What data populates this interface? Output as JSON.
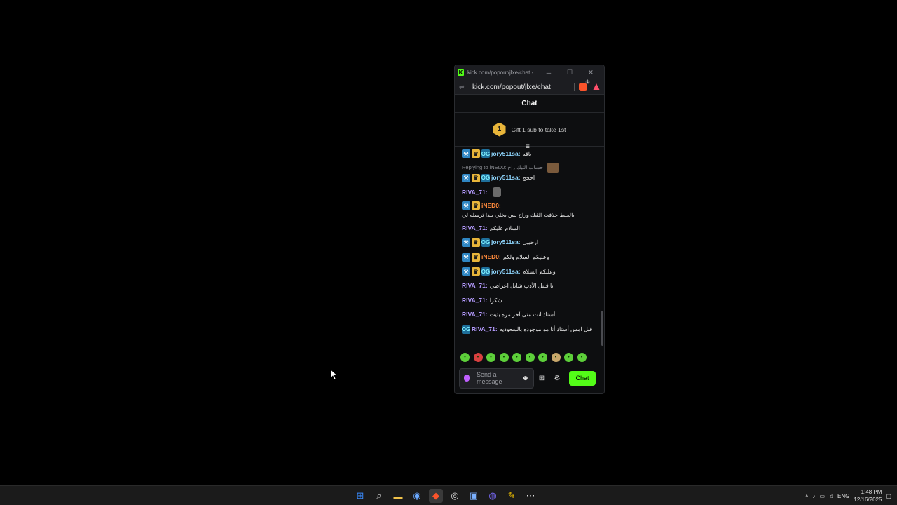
{
  "window": {
    "tab_title": "kick.com/popout/jlxe/chat -...",
    "url": "kick.com/popout/jlxe/chat",
    "favicon_letter": "K"
  },
  "chat": {
    "header": "Chat",
    "gift_rank": "1",
    "gift_text": "Gift 1 sub to take 1st",
    "input_placeholder": "Send a message",
    "chat_button": "Chat"
  },
  "messages": [
    {
      "type": "msg",
      "badges": [
        "mod",
        "vip",
        "og"
      ],
      "user": "jory511sa:",
      "ucls": "u-jory",
      "text": "باقه"
    },
    {
      "type": "reply",
      "text": "Replying to iNED0: حساب الثيك راح"
    },
    {
      "type": "msg",
      "badges": [
        "mod",
        "vip",
        "og"
      ],
      "user": "jory511sa:",
      "ucls": "u-jory",
      "text": "احجج"
    },
    {
      "type": "msg",
      "badges": [],
      "user": "RIVA_71:",
      "ucls": "u-riva",
      "text": "",
      "emote": true
    },
    {
      "type": "msg",
      "badges": [
        "mod",
        "vip"
      ],
      "user": "iNED0:",
      "ucls": "u-inedo",
      "text": "بالغلط حذفت الثيك وراح بس بخلي بيدا ترسله لي"
    },
    {
      "type": "msg",
      "badges": [],
      "user": "RIVA_71:",
      "ucls": "u-riva",
      "text": "السلام عليكم"
    },
    {
      "type": "msg",
      "badges": [
        "mod",
        "vip",
        "og"
      ],
      "user": "jory511sa:",
      "ucls": "u-jory",
      "text": "ارحبيي"
    },
    {
      "type": "msg",
      "badges": [
        "mod",
        "vip"
      ],
      "user": "iNED0:",
      "ucls": "u-inedo",
      "text": "وعليكم السلام ولكم"
    },
    {
      "type": "msg",
      "badges": [
        "mod",
        "vip",
        "og"
      ],
      "user": "jory511sa:",
      "ucls": "u-jory",
      "text": "وعليكم السلام"
    },
    {
      "type": "msg",
      "badges": [],
      "user": "RIVA_71:",
      "ucls": "u-riva",
      "text": "يا قليل الأدب شايل اعراضي"
    },
    {
      "type": "msg",
      "badges": [],
      "user": "RIVA_71:",
      "ucls": "u-riva",
      "text": "شكرا"
    },
    {
      "type": "msg",
      "badges": [],
      "user": "RIVA_71:",
      "ucls": "u-riva",
      "text": "أستاذ انت متى آخر مره بثيت"
    },
    {
      "type": "msg",
      "badges": [
        "og"
      ],
      "user": "RIVA_71:",
      "ucls": "u-riva",
      "text": "قبل امس أستاذ أنا مو موجوده بالسعوديه"
    }
  ],
  "taskbar": {
    "time": "1:48 PM",
    "date": "12/16/2025",
    "lang": "ENG"
  }
}
